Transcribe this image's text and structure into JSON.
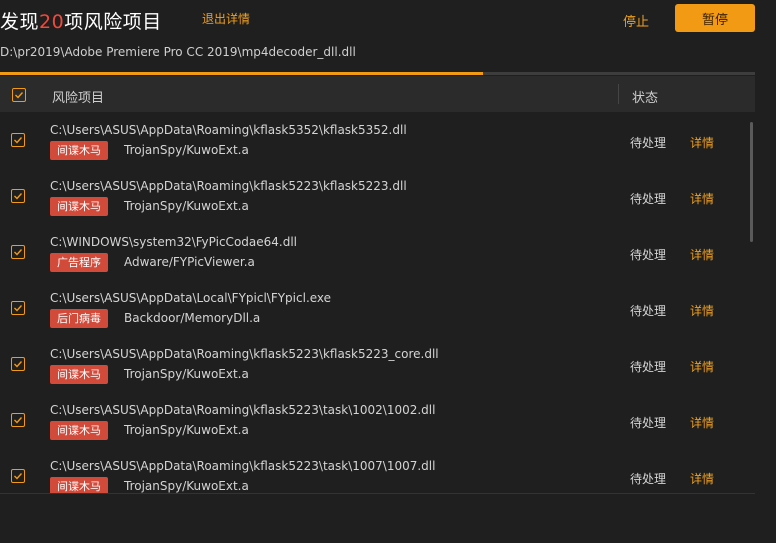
{
  "header": {
    "title_prefix": "发现",
    "risk_count": "20",
    "title_suffix": "项风险项目",
    "exit_details": "退出详情",
    "stop": "停止",
    "pause": "暂停",
    "scan_path": "D:\\pr2019\\Adobe Premiere Pro CC 2019\\mp4decoder_dll.dll"
  },
  "progress": {
    "fraction": 0.64
  },
  "table": {
    "col_risk": "风险项目",
    "col_status": "状态",
    "rows": [
      {
        "path": "C:\\Users\\ASUS\\AppData\\Roaming\\kflask5352\\kflask5352.dll",
        "tag": "间谍木马",
        "threat": "TrojanSpy/KuwoExt.a",
        "status": "待处理",
        "action": "详情"
      },
      {
        "path": "C:\\Users\\ASUS\\AppData\\Roaming\\kflask5223\\kflask5223.dll",
        "tag": "间谍木马",
        "threat": "TrojanSpy/KuwoExt.a",
        "status": "待处理",
        "action": "详情"
      },
      {
        "path": "C:\\WINDOWS\\system32\\FyPicCodae64.dll",
        "tag": "广告程序",
        "threat": "Adware/FYPicViewer.a",
        "status": "待处理",
        "action": "详情"
      },
      {
        "path": "C:\\Users\\ASUS\\AppData\\Local\\FYpicl\\FYpicl.exe",
        "tag": "后门病毒",
        "threat": "Backdoor/MemoryDll.a",
        "status": "待处理",
        "action": "详情"
      },
      {
        "path": "C:\\Users\\ASUS\\AppData\\Roaming\\kflask5223\\kflask5223_core.dll",
        "tag": "间谍木马",
        "threat": "TrojanSpy/KuwoExt.a",
        "status": "待处理",
        "action": "详情"
      },
      {
        "path": "C:\\Users\\ASUS\\AppData\\Roaming\\kflask5223\\task\\1002\\1002.dll",
        "tag": "间谍木马",
        "threat": "TrojanSpy/KuwoExt.a",
        "status": "待处理",
        "action": "详情"
      },
      {
        "path": "C:\\Users\\ASUS\\AppData\\Roaming\\kflask5223\\task\\1007\\1007.dll",
        "tag": "间谍木马",
        "threat": "TrojanSpy/KuwoExt.a",
        "status": "待处理",
        "action": "详情"
      }
    ]
  },
  "colors": {
    "accent": "#f39a14",
    "tag_red": "#d24a3a",
    "count_red": "#ef4a3c",
    "background": "#1f1f1f"
  },
  "icons": {
    "checkbox": "checkmark-icon"
  }
}
